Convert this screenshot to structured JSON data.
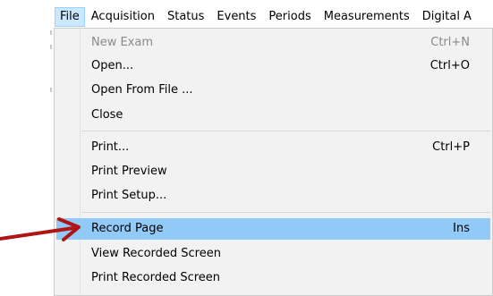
{
  "menubar": {
    "items": [
      "File",
      "Acquisition",
      "Status",
      "Events",
      "Periods",
      "Measurements",
      "Digital A"
    ]
  },
  "file_menu": {
    "items": [
      {
        "label": "New Exam",
        "shortcut": "Ctrl+N",
        "disabled": true
      },
      {
        "label": "Open...",
        "shortcut": "Ctrl+O"
      },
      {
        "label": "Open From File ...",
        "shortcut": ""
      },
      {
        "label": "Close",
        "shortcut": ""
      },
      {
        "label": "Print...",
        "shortcut": "Ctrl+P"
      },
      {
        "label": "Print Preview",
        "shortcut": ""
      },
      {
        "label": "Print Setup...",
        "shortcut": ""
      },
      {
        "label": "Record Page",
        "shortcut": "Ins",
        "highlighted": true
      },
      {
        "label": "View Recorded Screen",
        "shortcut": ""
      },
      {
        "label": "Print Recorded Screen",
        "shortcut": ""
      }
    ]
  },
  "colors": {
    "highlight": "#91c9f7",
    "menu_bg": "#f2f2f2",
    "arrow": "#b01515",
    "active_menu_bg": "#cce8ff"
  },
  "annotation": {
    "icon": "red-arrow-icon"
  }
}
